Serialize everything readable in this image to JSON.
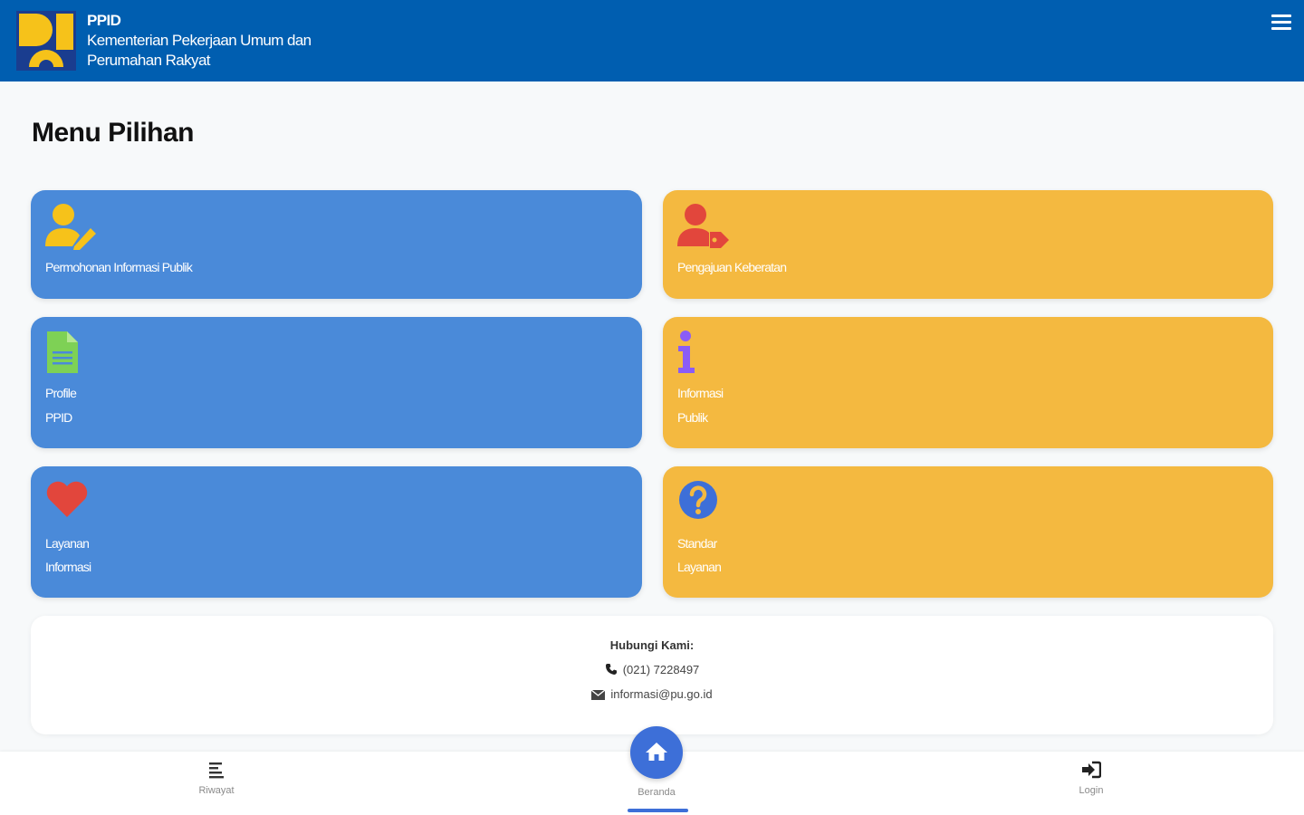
{
  "header": {
    "title": "PPID",
    "subtitle_line1": "Kementerian Pekerjaan Umum dan",
    "subtitle_line2": "Perumahan Rakyat"
  },
  "main": {
    "title": "Menu Pilihan",
    "cards": [
      {
        "line1": "Permohonan Informasi Publik",
        "line2": "",
        "icon": "user-edit-icon",
        "color": "#4a8ad9"
      },
      {
        "line1": "Pengajuan Keberatan",
        "line2": "",
        "icon": "user-tag-icon",
        "color": "#f4b940"
      },
      {
        "line1": "Profile",
        "line2": "PPID",
        "icon": "document-icon",
        "color": "#4a8ad9"
      },
      {
        "line1": "Informasi",
        "line2": "Publik",
        "icon": "info-icon",
        "color": "#f4b940"
      },
      {
        "line1": "Layanan",
        "line2": "Informasi",
        "icon": "heart-icon",
        "color": "#4a8ad9"
      },
      {
        "line1": "Standar",
        "line2": "Layanan",
        "icon": "question-icon",
        "color": "#f4b940"
      }
    ]
  },
  "contact": {
    "title": "Hubungi Kami:",
    "phone": "(021) 7228497",
    "email": "informasi@pu.go.id"
  },
  "bottom_nav": {
    "items": [
      {
        "label": "Riwayat",
        "icon": "list-icon"
      },
      {
        "label": "Beranda",
        "icon": "home-icon",
        "active": true
      },
      {
        "label": "Login",
        "icon": "login-icon"
      }
    ]
  },
  "colors": {
    "header": "#005eb0",
    "blue_card": "#4a8ad9",
    "orange_card": "#f4b940",
    "accent": "#3d6fd8"
  }
}
